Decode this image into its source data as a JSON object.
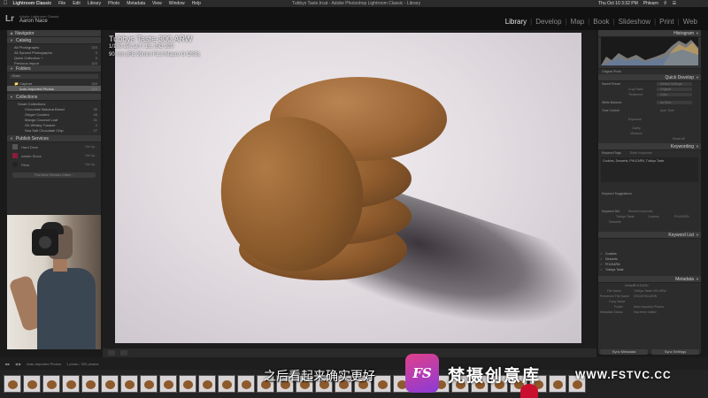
{
  "menubar": {
    "items": [
      "Lightroom Classic",
      "File",
      "Edit",
      "Library",
      "Photo",
      "Metadata",
      "View",
      "Window",
      "Help"
    ],
    "window_title": "Tubbys Taste.lrcat - Adobe Photoshop Lightroom Classic - Library",
    "clock": "Thu Oct 10 3:32 PM",
    "user": "Phlearn"
  },
  "identity": {
    "logo": "Lr",
    "catalog": "Adobe Lightroom Classic",
    "user_name": "Aaron Nace"
  },
  "modules": [
    "Library",
    "Develop",
    "Map",
    "Book",
    "Slideshow",
    "Print",
    "Web"
  ],
  "left_panel": {
    "navigator": "Navigator",
    "catalog": {
      "title": "Catalog",
      "items": [
        {
          "label": "All Photographs",
          "count": "320"
        },
        {
          "label": "All Synced Photographs",
          "count": "0"
        },
        {
          "label": "Quick Collection +",
          "count": "0"
        },
        {
          "label": "Previous Import",
          "count": "320"
        }
      ]
    },
    "folders": {
      "title": "Folders",
      "volume": "Roiav",
      "items": [
        {
          "label": "Capture",
          "count": "320"
        },
        {
          "label": "Auto-Imported Photos",
          "count": "320"
        }
      ]
    },
    "collections": {
      "title": "Collections",
      "items": [
        {
          "label": "Smart Collections",
          "count": ""
        },
        {
          "label": "Chocolate Banana Bread",
          "count": "30"
        },
        {
          "label": "Ginger Cookies",
          "count": "45"
        },
        {
          "label": "Mango Coconut Loaf",
          "count": "31"
        },
        {
          "label": "Oh Whisky Tunacie",
          "count": "2"
        },
        {
          "label": "Sea Salt Chocolate Chip",
          "count": "27"
        }
      ]
    },
    "publish": {
      "title": "Publish Services",
      "items": [
        {
          "label": "Hard Drive",
          "setup": "Set Up..."
        },
        {
          "label": "Adobe Stock",
          "setup": "Set Up..."
        },
        {
          "label": "Flickr",
          "setup": "Set Up..."
        }
      ],
      "find_more": "Find More Services Online..."
    }
  },
  "photo": {
    "filename": "Tubbys Taste-300.ARW",
    "exposure": "1/160 sec at f / 16, ISO 200",
    "lens": "90 mm (FE 90mm F2.8 Macro G OSS)"
  },
  "right_panel": {
    "histogram": "Histogram",
    "original_photo": "Original Photo",
    "quick_develop": {
      "title": "Quick Develop",
      "saved_preset": {
        "label": "Saved Preset",
        "value": "Default Settings"
      },
      "crop_ratio": {
        "label": "Crop Ratio",
        "value": "Original"
      },
      "treatment": {
        "label": "Treatment",
        "value": "Color"
      },
      "white_balance": {
        "label": "White Balance",
        "value": "As Shot"
      },
      "tone_control": {
        "label": "Tone Control",
        "value": "Auto Tone"
      },
      "exposure": "Exposure",
      "clarity": "Clarity",
      "vibrance": "Vibrance",
      "reset": "Reset All"
    },
    "keywording": {
      "title": "Keywording",
      "tags_label": "Keyword Tags",
      "tags_mode": "Enter Keywords",
      "tags_text": "Cookies, Desserts, PHLEARN, Tubbys Taste",
      "suggestions": "Keyword Suggestions",
      "set_label": "Keyword Set",
      "set_value": "Recent Keywords",
      "set_items": [
        "Tubbys Taste",
        "Cookies",
        "PHLEARN",
        "Desserts"
      ]
    },
    "keyword_list": {
      "title": "Keyword List",
      "items": [
        "Cookies",
        "Desserts",
        "PHLEARN",
        "Tubbys Taste"
      ]
    },
    "metadata": {
      "title": "Metadata",
      "preset": {
        "label": "Default",
        "value": "PHLEARN"
      },
      "fields": [
        {
          "label": "File Name",
          "value": "Tubbys Taste-300.ARW"
        },
        {
          "label": "Preserved File Name",
          "value": "DSC00784.ARW"
        },
        {
          "label": "Copy Name",
          "value": ""
        },
        {
          "label": "Folder",
          "value": "Auto-Imported Photos"
        },
        {
          "label": "Metadata Status",
          "value": "Has been edited"
        }
      ]
    },
    "sync_metadata": "Sync Metadata",
    "sync_settings": "Sync Settings"
  },
  "filmstrip": {
    "source": "Auto-Imported Photos",
    "info": "1 photo / 320 photos",
    "thumb_count": 30
  },
  "overlay": {
    "subtitle": "之后看起来确实更好",
    "watermark_logo": "FS",
    "watermark_cn": "梵摄创意库",
    "watermark_url": "WWW.FSTVC.CC"
  }
}
